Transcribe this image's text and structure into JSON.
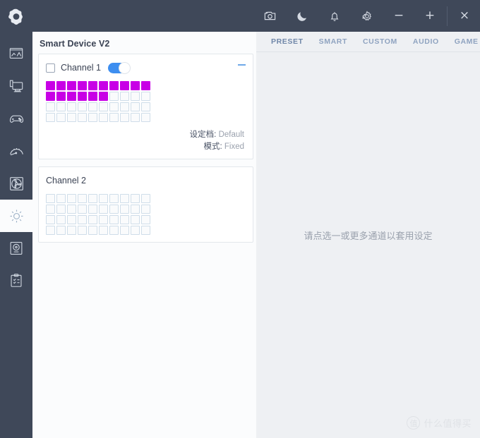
{
  "titlebar": {
    "logo_name": "nzxt-cam-logo",
    "actions": [
      {
        "name": "screenshot-icon",
        "label": "camera"
      },
      {
        "name": "dark-mode-icon",
        "label": "moon"
      },
      {
        "name": "notifications-icon",
        "label": "bell"
      },
      {
        "name": "settings-icon",
        "label": "gear"
      }
    ],
    "window_controls": {
      "minimize": "−",
      "maximize": "+",
      "close": "×"
    }
  },
  "sidebar": {
    "items": [
      {
        "name": "sidebar-item-dashboard",
        "icon": "dashboard-icon",
        "active": false
      },
      {
        "name": "sidebar-item-pc-monitoring",
        "icon": "monitor-icon",
        "active": false
      },
      {
        "name": "sidebar-item-games",
        "icon": "gamepad-icon",
        "active": false
      },
      {
        "name": "sidebar-item-performance",
        "icon": "gauge-icon",
        "active": false
      },
      {
        "name": "sidebar-item-cooling",
        "icon": "fan-icon",
        "active": false
      },
      {
        "name": "sidebar-item-lighting",
        "icon": "sun-icon",
        "active": true
      },
      {
        "name": "sidebar-item-storage",
        "icon": "disk-icon",
        "active": false
      },
      {
        "name": "sidebar-item-overview",
        "icon": "checklist-icon",
        "active": false
      }
    ]
  },
  "device": {
    "title": "Smart Device V2",
    "channels": [
      {
        "label": "Channel 1",
        "checked": false,
        "toggle_on": true,
        "collapse_icon": "collapse-icon",
        "led_rows": [
          [
            "on",
            "on",
            "on",
            "on",
            "on",
            "on",
            "on",
            "on",
            "on",
            "on"
          ],
          [
            "on",
            "on",
            "on",
            "on",
            "on",
            "on",
            "off",
            "off",
            "off",
            "off"
          ],
          [
            "off",
            "off",
            "off",
            "off",
            "off",
            "off",
            "off",
            "off",
            "off",
            "off"
          ],
          [
            "off",
            "off",
            "off",
            "off",
            "off",
            "off",
            "off",
            "off",
            "off",
            "off"
          ]
        ],
        "settings": [
          {
            "label": "设定档:",
            "value": "Default"
          },
          {
            "label": "模式:",
            "value": "Fixed"
          }
        ]
      },
      {
        "label": "Channel 2",
        "checked": null,
        "toggle_on": null,
        "collapse_icon": null,
        "led_rows": [
          [
            "off",
            "off",
            "off",
            "off",
            "off",
            "off",
            "off",
            "off",
            "off",
            "off"
          ],
          [
            "off",
            "off",
            "off",
            "off",
            "off",
            "off",
            "off",
            "off",
            "off",
            "off"
          ],
          [
            "off",
            "off",
            "off",
            "off",
            "off",
            "off",
            "off",
            "off",
            "off",
            "off"
          ],
          [
            "off",
            "off",
            "off",
            "off",
            "off",
            "off",
            "off",
            "off",
            "off",
            "off"
          ]
        ],
        "settings": []
      }
    ]
  },
  "right_panel": {
    "tabs": [
      {
        "label": "PRESET",
        "active": true
      },
      {
        "label": "SMART",
        "active": false
      },
      {
        "label": "CUSTOM",
        "active": false
      },
      {
        "label": "AUDIO",
        "active": false
      },
      {
        "label": "GAME",
        "active": false
      }
    ],
    "empty_message": "请点选一或更多通道以套用设定"
  },
  "watermark": {
    "mark": "值",
    "text": "什么值得买"
  },
  "colors": {
    "titlebar": "#3f4859",
    "led_on": "#c800e6",
    "accent": "#3d8ef0",
    "panel_bg": "#eef0f3"
  }
}
